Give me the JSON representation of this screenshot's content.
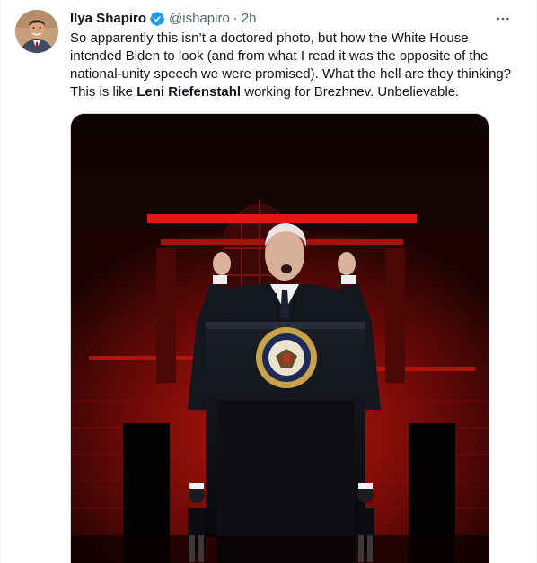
{
  "tweet": {
    "author_name": "Ilya Shapiro",
    "handle": "@ishapiro",
    "separator": "·",
    "time": "2h",
    "text_part1": "So apparently this isn’t a doctored photo, but how the White House intended Biden to look (and from what I read it was the opposite of the national-unity speech we were promised). What the hell are they thinking? This is like ",
    "text_bold": "Leni Riefenstahl",
    "text_part2": " working for Brezhnev. Unbelievable."
  },
  "icons": {
    "verified": "verified-badge-icon",
    "more": "more-options-icon"
  },
  "colors": {
    "verified_blue": "#1d9bf0",
    "secondary_text": "#536471",
    "primary_text": "#0f1419",
    "border": "#cfd9de",
    "backdrop_red": "#b3120c"
  }
}
